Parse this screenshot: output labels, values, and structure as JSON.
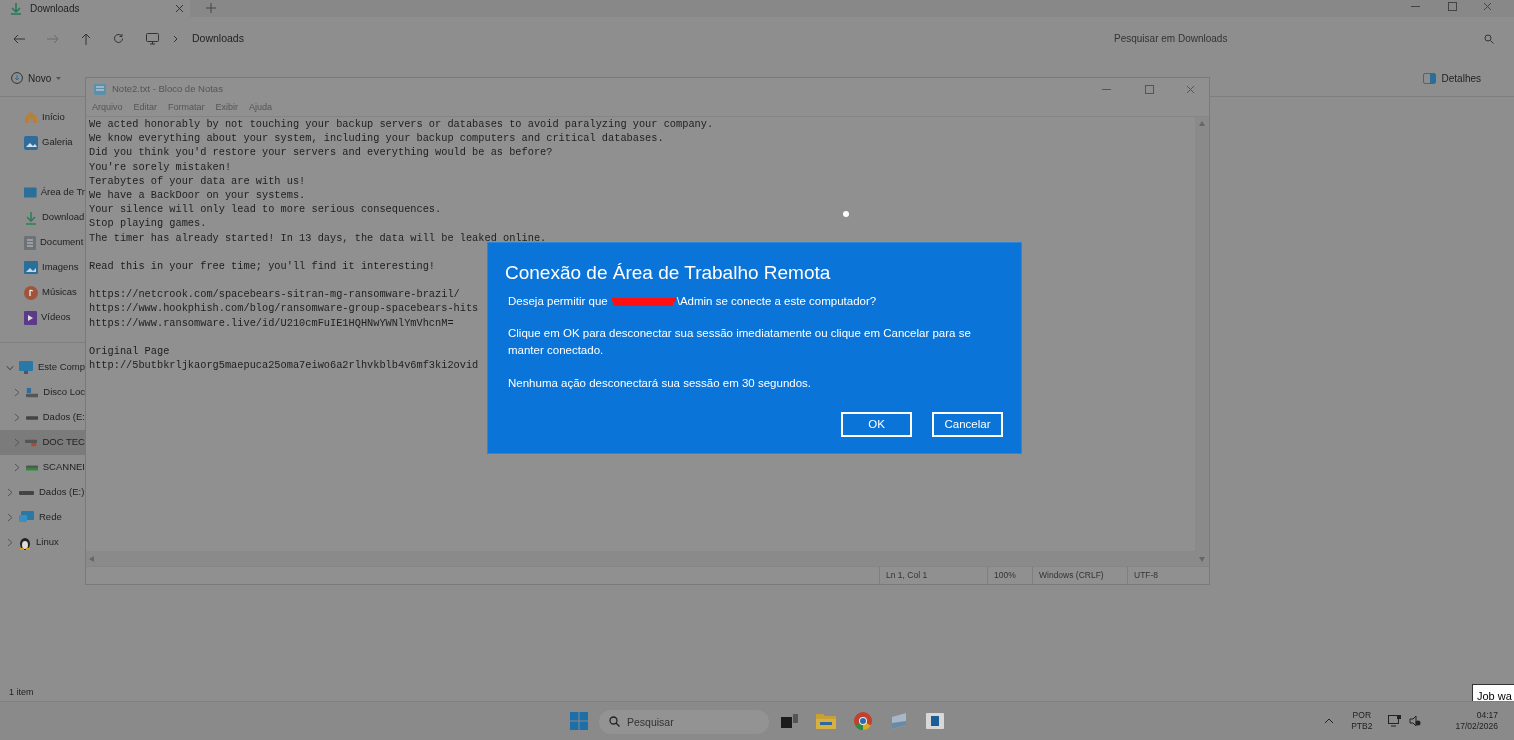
{
  "explorer": {
    "tab": {
      "title": "Downloads"
    },
    "breadcrumb": "Downloads",
    "search": {
      "placeholder": "Pesquisar em Downloads"
    },
    "toolbar": {
      "new": "Novo",
      "details": "Detalhes"
    },
    "sidebar": {
      "items": [
        {
          "label": "Início",
          "kind": "home"
        },
        {
          "label": "Galeria",
          "kind": "gallery"
        },
        {
          "label": "Área de Tr",
          "kind": "desktop"
        },
        {
          "label": "Download",
          "kind": "download"
        },
        {
          "label": "Document",
          "kind": "document"
        },
        {
          "label": "Imagens",
          "kind": "images"
        },
        {
          "label": "Músicas",
          "kind": "music"
        },
        {
          "label": "Vídeos",
          "kind": "video"
        }
      ],
      "tree": [
        {
          "label": "Este Comp",
          "kind": "computer",
          "expanded": true,
          "selected": false,
          "children": [
            {
              "label": "Disco Loc",
              "kind": "system",
              "expanded": false,
              "selected": false
            },
            {
              "label": "Dados (E:",
              "kind": "drive",
              "expanded": false,
              "selected": false
            },
            {
              "label": "DOC TEC",
              "kind": "share",
              "expanded": false,
              "selected": true
            },
            {
              "label": "SCANNEI",
              "kind": "scanner",
              "expanded": false,
              "selected": false
            }
          ]
        },
        {
          "label": "Dados (E:)",
          "kind": "drive",
          "expanded": false,
          "selected": false
        },
        {
          "label": "Rede",
          "kind": "network",
          "expanded": false,
          "selected": false
        },
        {
          "label": "Linux",
          "kind": "linux",
          "expanded": false,
          "selected": false
        }
      ]
    },
    "status": "1 item"
  },
  "notepad": {
    "title": "Note2.txt - Bloco de Notas",
    "menu": [
      "Arquivo",
      "Editar",
      "Formatar",
      "Exibir",
      "Ajuda"
    ],
    "blocks": [
      [
        "We acted honorably by not touching your backup servers or databases to avoid paralyzing your company.",
        "We know everything about your system, including your backup computers and critical databases.",
        "Did you think you'd restore your servers and everything would be as before?",
        "You're sorely mistaken!",
        "Terabytes of your data are with us!",
        "We have a BackDoor on your systems.",
        "Your silence will only lead to more serious consequences.",
        "Stop playing games.",
        "The timer has already started! In 13 days, the data will be leaked online."
      ],
      [
        "Read this in your free time; you'll find it interesting!"
      ],
      [
        "https://netcrook.com/spacebears-sitran-mg-ransomware-brazil/",
        "https://www.hookphish.com/blog/ransomware-group-spacebears-hits",
        "https://www.ransomware.live/id/U210cmFuIE1HQHNwYWNlYmVhcnM="
      ],
      [
        "Original Page",
        "http://5butbkrljkaorg5maepuca25oma7eiwo6a2rlhvkblb4v6mf3ki2ovid"
      ]
    ],
    "status": [
      "Ln 1, Col 1",
      "100%",
      "Windows (CRLF)",
      "UTF-8"
    ]
  },
  "dialog": {
    "title": "Conexão de Área de Trabalho Remota",
    "question_before": "Deseja permitir que",
    "question_after": "\\Admin se conecte a este computador?",
    "paragraphs": [
      "Clique em OK para desconectar sua sessão imediatamente ou clique em Cancelar para se manter conectado.",
      "Nenhuma ação desconectará sua sessão em 30 segundos."
    ],
    "buttons": [
      "OK",
      "Cancelar"
    ]
  },
  "taskbar": {
    "search": {
      "placeholder": "Pesquisar"
    },
    "language": [
      "POR",
      "PTB2"
    ],
    "time": "04:17",
    "date": "17/02/2026"
  },
  "tooltip": "Job wa"
}
